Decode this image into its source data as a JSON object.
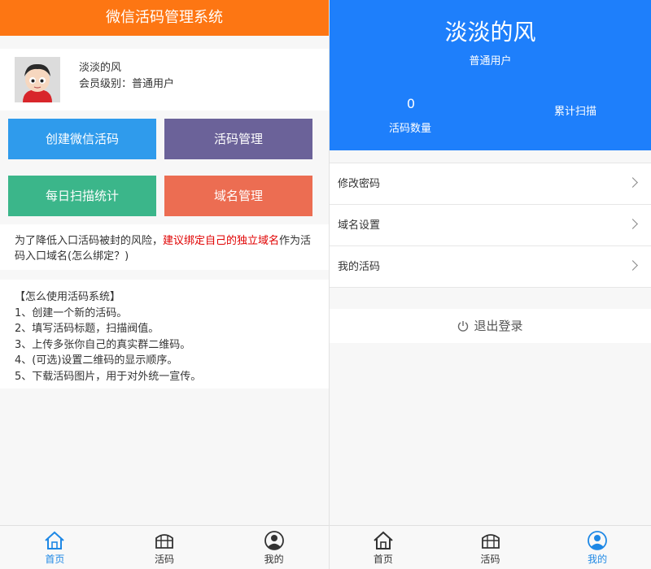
{
  "left": {
    "header_title": "微信活码管理系统",
    "profile": {
      "name": "淡淡的风",
      "level": "会员级别：普通用户"
    },
    "buttons": [
      {
        "label": "创建微信活码",
        "color": "#2f9bec"
      },
      {
        "label": "活码管理",
        "color": "#6b6299"
      },
      {
        "label": "每日扫描统计",
        "color": "#3bb68a"
      },
      {
        "label": "域名管理",
        "color": "#ec6d52"
      }
    ],
    "tip": {
      "prefix": "为了降低入口活码被封的风险，",
      "warn": "建议绑定自己的独立域名",
      "suffix": "作为活码入口域名(怎么绑定？)"
    },
    "howto": {
      "title": "【怎么使用活码系统】",
      "steps": [
        "1、创建一个新的活码。",
        "2、填写活码标题，扫描阀值。",
        "3、上传多张你自己的真实群二维码。",
        "4、(可选)设置二维码的显示顺序。",
        "5、下载活码图片，用于对外统一宣传。"
      ]
    },
    "tabs": {
      "home": "首页",
      "codes": "活码",
      "mine": "我的"
    }
  },
  "right": {
    "name": "淡淡的风",
    "role": "普通用户",
    "code_count": "0",
    "code_count_label": "活码数量",
    "scan_label": "累计扫描",
    "menu": [
      "修改密码",
      "域名设置",
      "我的活码"
    ],
    "logout": "退出登录",
    "tabs": {
      "home": "首页",
      "codes": "活码",
      "mine": "我的"
    }
  },
  "colors": {
    "left_header": "#fd7613",
    "right_header": "#1e7ffb",
    "active_tab": "#1e88e5",
    "warn_text": "#e00000"
  }
}
